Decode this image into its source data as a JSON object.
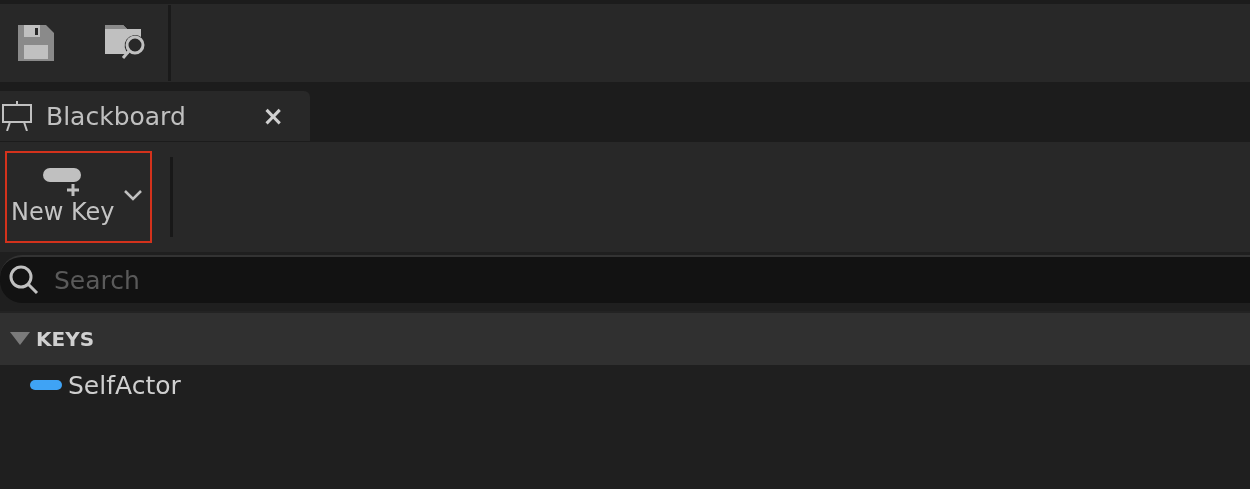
{
  "toolbar": {
    "buttons": [
      {
        "kind": "save"
      },
      {
        "kind": "browse"
      }
    ]
  },
  "tabs": [
    {
      "label": "Blackboard",
      "close": "×",
      "selected": true
    }
  ],
  "new_key_button": {
    "label": "New Key",
    "highlighted": true
  },
  "search": {
    "placeholder": "Search"
  },
  "keys_section": {
    "title": "KEYS",
    "expanded": true,
    "items": [
      {
        "label": "SelfActor",
        "color": "#3fa3f5"
      }
    ]
  }
}
